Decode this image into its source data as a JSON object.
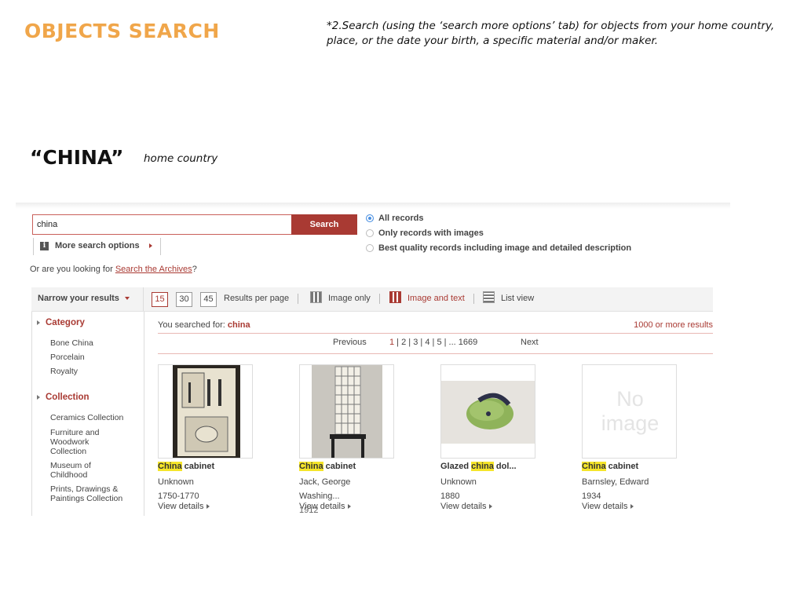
{
  "slide": {
    "title": "OBJECTS SEARCH",
    "instruction": "*2.Search (using the ‘search more options’ tab) for objects from your home country, place, or the date your birth, a specific material and/or maker.",
    "term": "“CHINA”",
    "term_note": "home country"
  },
  "search": {
    "value": "china",
    "button_label": "Search",
    "more_options_label": "More search options",
    "info_glyph": "i"
  },
  "record_filter": {
    "options": [
      {
        "label": "All records",
        "selected": true
      },
      {
        "label": "Only records with images",
        "selected": false
      },
      {
        "label": "Best quality records including image and detailed description",
        "selected": false
      }
    ]
  },
  "archives": {
    "prefix": "Or are you looking for ",
    "link": "Search the Archives",
    "suffix": "?"
  },
  "toolbar": {
    "narrow_label": "Narrow your results",
    "per_page_options": [
      "15",
      "30",
      "45"
    ],
    "per_page_label": "Results per page",
    "views": [
      "Image only",
      "Image and text",
      "List view"
    ],
    "active_view": "Image and text"
  },
  "facets": [
    {
      "heading": "Category",
      "items": [
        "Bone China",
        "Porcelain",
        "Royalty"
      ]
    },
    {
      "heading": "Collection",
      "items": [
        "Ceramics Collection",
        "Furniture and Woodwork Collection",
        "Museum of Childhood",
        "Prints, Drawings & Paintings Collection"
      ]
    }
  ],
  "results": {
    "searched_prefix": "You searched for: ",
    "term": "china",
    "count": "1000 or more results",
    "pager": {
      "previous": "Previous",
      "pages": [
        "1",
        "2",
        "3",
        "4",
        "5"
      ],
      "ellipsis": "... 1669",
      "next": "Next",
      "current": "1"
    },
    "view_details": "View details",
    "no_image": [
      "No",
      "image"
    ],
    "items": [
      {
        "highlight": "China",
        "title_rest": " cabinet",
        "maker": "Unknown",
        "date": "1750-1770",
        "place": ""
      },
      {
        "highlight": "China",
        "title_rest": " cabinet",
        "maker": "Jack, George",
        "date": "1912",
        "place": "Washing..."
      },
      {
        "title_pre": "Glazed ",
        "highlight": "china",
        "title_rest": " dol...",
        "maker": "Unknown",
        "date": "1880",
        "place": ""
      },
      {
        "highlight": "China",
        "title_rest": " cabinet",
        "maker": "Barnsley, Edward",
        "date": "1934",
        "place": ""
      }
    ]
  },
  "colors": {
    "accent": "#a93a33",
    "title_orange": "#f0a64a",
    "highlight": "#f5e52a",
    "radio_blue": "#4a90e2"
  }
}
